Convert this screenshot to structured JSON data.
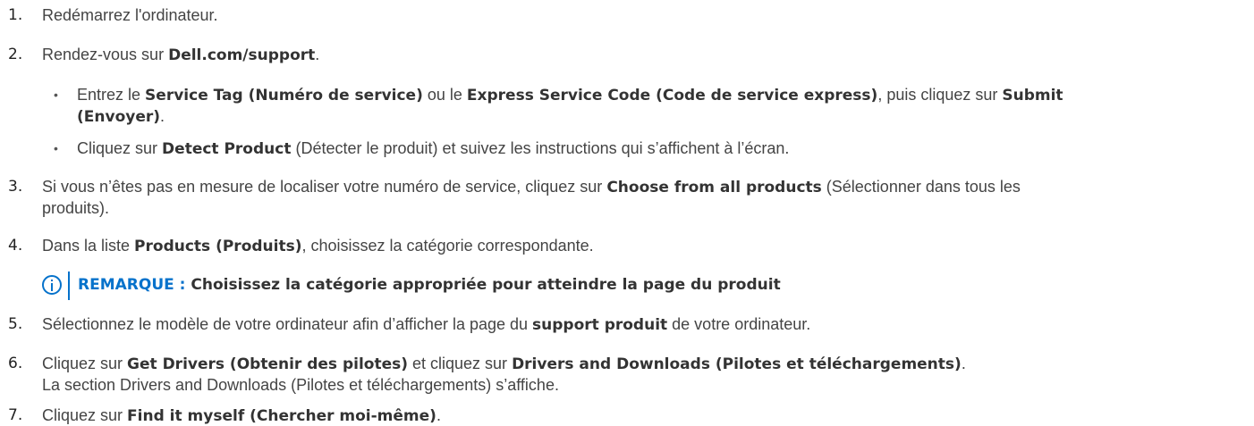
{
  "steps": [
    {
      "num": "1.",
      "text": "Redémarrez l'ordinateur."
    },
    {
      "num": "2.",
      "pre": "Rendez-vous sur ",
      "bold": "Dell.com/support",
      "post": "."
    },
    {
      "num": "3.",
      "line1_pre": "Si vous n’êtes pas en mesure de localiser votre numéro de service, cliquez sur ",
      "line1_bold": "Choose from all products",
      "line1_post": " (Sélectionner dans tous les",
      "line2": "produits)."
    },
    {
      "num": "4.",
      "pre": "Dans la liste ",
      "bold": "Products (Produits)",
      "post": ", choisissez la catégorie correspondante."
    },
    {
      "num": "5.",
      "pre": "Sélectionnez le modèle de votre ordinateur afin d’afficher la page du ",
      "bold": "support produit",
      "post": " de votre ordinateur."
    },
    {
      "num": "6.",
      "pre": "Cliquez sur ",
      "bold1": "Get Drivers (Obtenir des pilotes)",
      "mid": " et cliquez sur ",
      "bold2": "Drivers and Downloads (Pilotes et téléchargements)",
      "post": ".",
      "line2": "La section Drivers and Downloads (Pilotes et téléchargements) s’affiche."
    },
    {
      "num": "7.",
      "pre": "Cliquez sur ",
      "bold": "Find it myself (Chercher moi-même)",
      "post": "."
    }
  ],
  "substeps": [
    {
      "bullet": "•",
      "pre": "Entrez le ",
      "bold1": "Service Tag (Numéro de service)",
      "mid1": " ou le ",
      "bold2": "Express Service Code (Code de service express)",
      "mid2": ", puis cliquez sur ",
      "bold3": "Submit",
      "line2_bold": "(Envoyer)",
      "line2_post": "."
    },
    {
      "bullet": "•",
      "pre": "Cliquez sur ",
      "bold": "Detect Product",
      "post": " (Détecter le produit) et suivez les instructions qui s’affichent à l’écran."
    }
  ],
  "note": {
    "label": "REMARQUE :",
    "text": " Choisissez la catégorie appropriée pour atteindre la page du produit",
    "icon": "info-icon",
    "accent": "#0672cb"
  }
}
